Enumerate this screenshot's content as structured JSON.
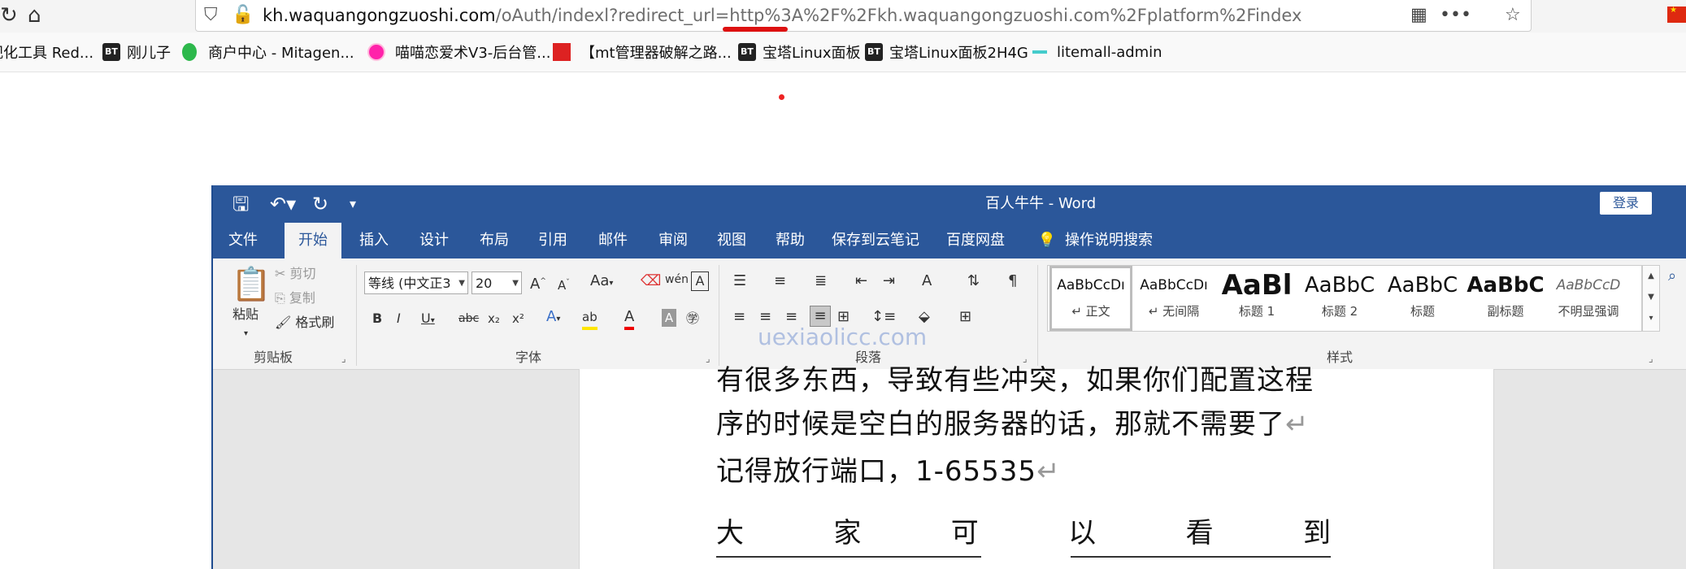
{
  "browser": {
    "url_domain": "kh.waquangongzuoshi.com",
    "url_path": "/oAuth/indexl?redirect_url=http%3A%2F%2Fkh.waquangongzuoshi.com%2Fplatform%2Findex"
  },
  "bookmarks": [
    {
      "icon": "none",
      "label": "视化工具 Red..."
    },
    {
      "icon": "bt-logo",
      "label": "刚儿子"
    },
    {
      "icon": "green-dot",
      "label": "商户中心 - Mitagen..."
    },
    {
      "icon": "pink-dot",
      "label": "喵喵恋爱术V3-后台管..."
    },
    {
      "icon": "red-square",
      "label": "【mt管理器破解之路..."
    },
    {
      "icon": "bt-logo",
      "label": "宝塔Linux面板"
    },
    {
      "icon": "bt-logo",
      "label": "宝塔Linux面板2H4G"
    },
    {
      "icon": "dash",
      "label": "litemall-admin"
    }
  ],
  "word": {
    "title": "百人牛牛  -  Word",
    "login_label": "登录",
    "tabs": [
      "文件",
      "开始",
      "插入",
      "设计",
      "布局",
      "引用",
      "邮件",
      "审阅",
      "视图",
      "帮助",
      "保存到云笔记",
      "百度网盘",
      "操作说明搜索"
    ],
    "active_tab": "开始",
    "clipboard": {
      "paste": "粘贴",
      "cut": "剪切",
      "copy": "复制",
      "format_painter": "格式刷",
      "group": "剪贴板"
    },
    "font": {
      "name": "等线 (中文正3",
      "size": "20",
      "group": "字体",
      "change_case": "Aa"
    },
    "paragraph": {
      "group": "段落"
    },
    "styles": {
      "group": "样式",
      "items": [
        {
          "preview": "AaBbCcDı",
          "name": "正文"
        },
        {
          "preview": "AaBbCcDı",
          "name": "无间隔"
        },
        {
          "preview": "AaBl",
          "name": "标题 1"
        },
        {
          "preview": "AaBbC",
          "name": "标题 2"
        },
        {
          "preview": "AaBbC",
          "name": "标题"
        },
        {
          "preview": "AaBbC",
          "name": "副标题"
        },
        {
          "preview": "AaBbCcD",
          "name": "不明显强调"
        }
      ]
    },
    "watermark": "uexiaolicc.com",
    "document": {
      "line1": "有很多东西，导致有些冲突，如果你们配置这程",
      "line2": "序的时候是空白的服务器的话，那就不需要了",
      "line3": "记得放行端口，1-65535",
      "spread_chars": [
        "大",
        "家",
        "可",
        "以",
        "看",
        "到"
      ],
      "para_mark": "↵"
    }
  }
}
